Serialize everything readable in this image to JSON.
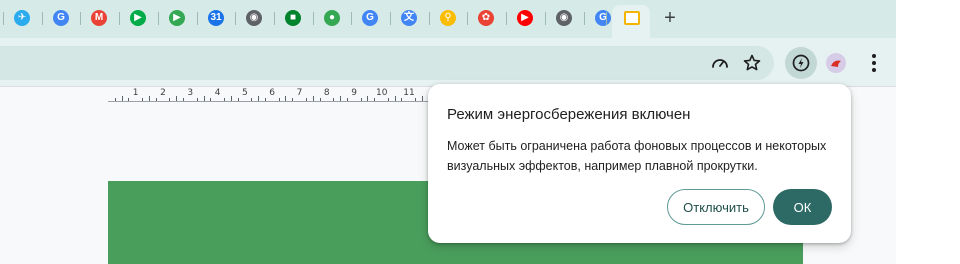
{
  "tabs": [
    {
      "icon": "telegram-icon",
      "color": "#2aabee",
      "glyph": "✈"
    },
    {
      "icon": "google-icon",
      "color": "#4285f4",
      "glyph": "G"
    },
    {
      "icon": "gmail-icon",
      "color": "#ea4335",
      "glyph": "M"
    },
    {
      "icon": "google-meet-icon",
      "color": "#00ac47",
      "glyph": "▶"
    },
    {
      "icon": "google-play-icon",
      "color": "#34a853",
      "glyph": "▶"
    },
    {
      "icon": "google-calendar-icon",
      "color": "#1a73e8",
      "glyph": "31"
    },
    {
      "icon": "chrome-icon",
      "color": "#5f6368",
      "glyph": "◉"
    },
    {
      "icon": "google-chat-icon",
      "color": "#00832d",
      "glyph": "■"
    },
    {
      "icon": "google-maps-icon",
      "color": "#34a853",
      "glyph": "●"
    },
    {
      "icon": "google-icon",
      "color": "#4285f4",
      "glyph": "G"
    },
    {
      "icon": "google-translate-icon",
      "color": "#4285f4",
      "glyph": "文"
    },
    {
      "icon": "google-shopping-icon",
      "color": "#fbbc04",
      "glyph": "⚲"
    },
    {
      "icon": "google-photos-icon",
      "color": "#ea4335",
      "glyph": "✿"
    },
    {
      "icon": "youtube-music-icon",
      "color": "#ff0000",
      "glyph": "▶"
    },
    {
      "icon": "chrome-icon",
      "color": "#5f6368",
      "glyph": "◉"
    },
    {
      "icon": "google-icon",
      "color": "#4285f4",
      "glyph": "G"
    }
  ],
  "active_tab": {
    "icon": "google-slides-icon",
    "color": "#f4b400"
  },
  "new_tab_label": "+",
  "ruler": {
    "numbers": [
      "1",
      "2",
      "3",
      "4",
      "5",
      "6",
      "7",
      "8",
      "9",
      "10",
      "11"
    ]
  },
  "popup": {
    "title": "Режим энергосбережения включен",
    "body": "Может быть ограничена работа фоновых процессов и некоторых визуальных эффектов, например плавной прокрутки.",
    "button_off": "Отключить",
    "button_ok": "ОК"
  },
  "colors": {
    "tabstrip": "#d6ebe8",
    "toolbar": "#e6f2f1",
    "slide": "#4a9e5c",
    "ok_button": "#2d6a65"
  }
}
